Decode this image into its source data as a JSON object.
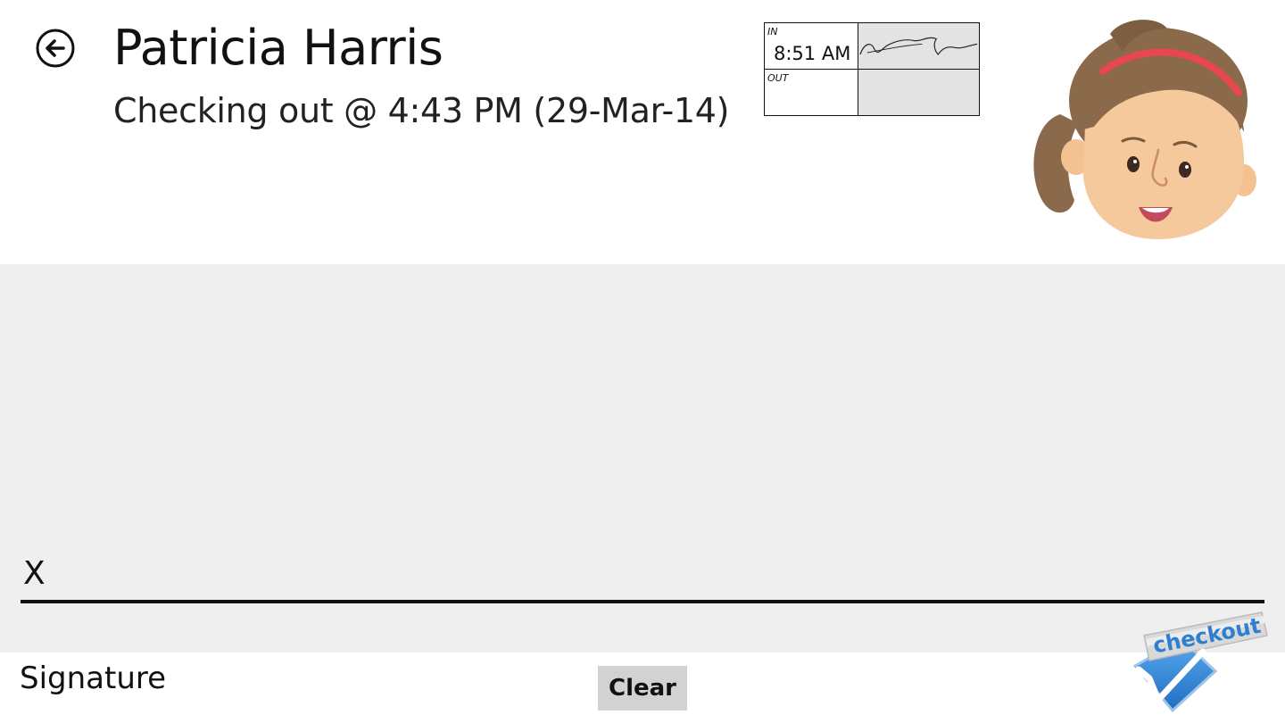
{
  "header": {
    "name": "Patricia Harris",
    "status": "Checking out @ 4:43 PM (29-Mar-14)"
  },
  "timecard": {
    "in_label": "IN",
    "in_time": "8:51 AM",
    "out_label": "OUT",
    "out_time": ""
  },
  "icons": {
    "back": "back-arrow-icon",
    "avatar": "girl-avatar",
    "checkout": "checkout-checkmark-icon"
  },
  "signature_pad": {
    "x_mark": "X",
    "label": "Signature"
  },
  "actions": {
    "clear_label": "Clear",
    "checkout_label": "checkout"
  },
  "colors": {
    "pad_background": "#efefef",
    "clear_button": "#d2d2d2",
    "checkout_blue": "#2f7fd0",
    "headband_red": "#e8474f",
    "hair_brown": "#8a6a4a",
    "skin": "#f6c99c"
  }
}
